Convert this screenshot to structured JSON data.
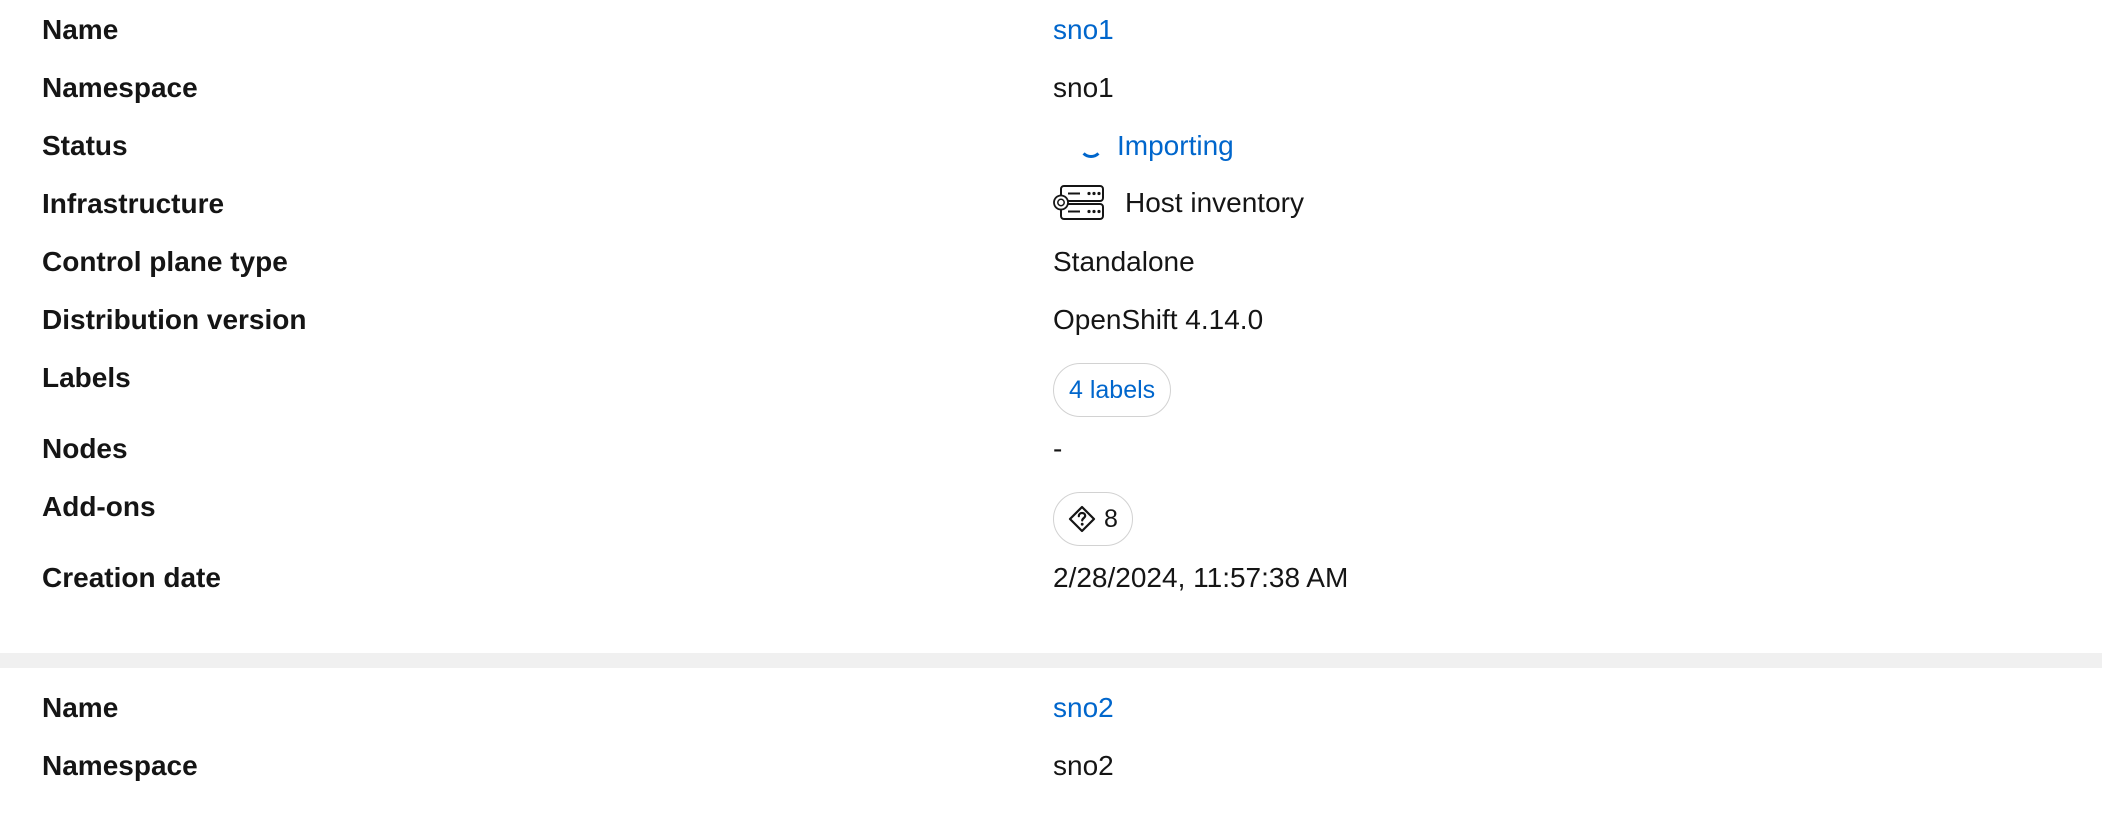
{
  "clusters": [
    {
      "name_label": "Name",
      "name": "sno1",
      "namespace_label": "Namespace",
      "namespace": "sno1",
      "status_label": "Status",
      "status": "Importing",
      "infrastructure_label": "Infrastructure",
      "infrastructure": "Host inventory",
      "control_plane_label": "Control plane type",
      "control_plane": "Standalone",
      "distribution_label": "Distribution version",
      "distribution": "OpenShift 4.14.0",
      "labels_label": "Labels",
      "labels": "4 labels",
      "nodes_label": "Nodes",
      "nodes": "-",
      "addons_label": "Add-ons",
      "addons": "8",
      "creation_label": "Creation date",
      "creation": "2/28/2024, 11:57:38 AM"
    },
    {
      "name_label": "Name",
      "name": "sno2",
      "namespace_label": "Namespace",
      "namespace": "sno2"
    }
  ],
  "colors": {
    "link": "#0066cc",
    "text": "#151515",
    "separator": "#f0f0f0"
  },
  "icons": {
    "status": "spinner-icon",
    "infrastructure": "host-inventory-icon",
    "addons": "help-diamond-icon"
  }
}
